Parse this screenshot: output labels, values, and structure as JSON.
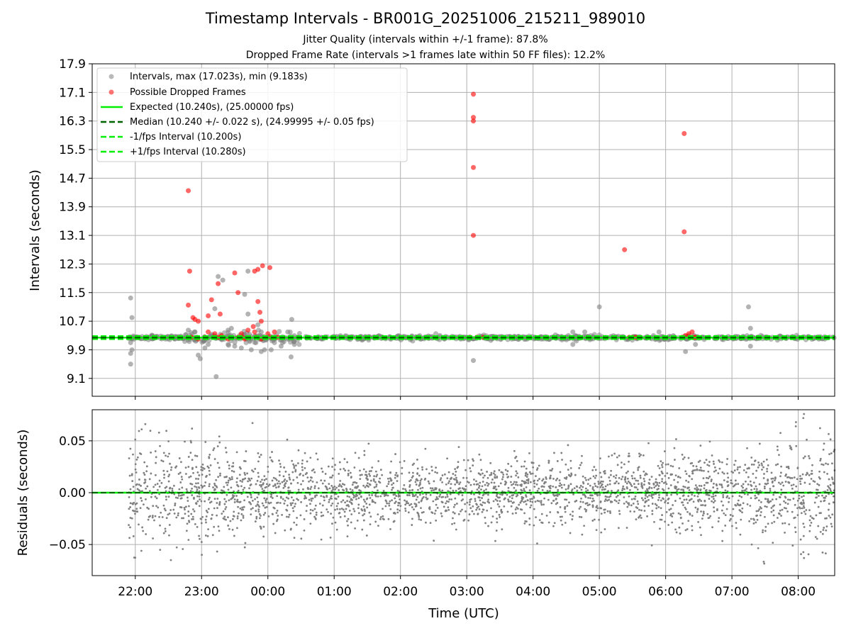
{
  "title": "Timestamp Intervals - BR001G_20251006_215211_989010",
  "subtitle_1": "Jitter Quality (intervals within +/-1 frame): 87.8%",
  "subtitle_2": "Dropped Frame Rate (intervals >1 frames late within 50 FF files): 12.2%",
  "colors": {
    "intervals": "#808080",
    "dropped": "#ff0000",
    "expected": "#00ee00",
    "median": "#006400",
    "fps_bounds": "#00ee00",
    "grid": "#b0b0b0"
  },
  "chart_data": [
    {
      "type": "scatter",
      "panel": "intervals",
      "ylabel": "Intervals (seconds)",
      "xlabel": "",
      "x_unit": "hours since 00:00 UTC",
      "xlim": [
        -2.65,
        8.55
      ],
      "ylim": [
        8.6,
        17.9
      ],
      "yticks": [
        9.1,
        9.9,
        10.7,
        11.5,
        12.3,
        13.1,
        13.9,
        14.7,
        15.5,
        16.3,
        17.1,
        17.9
      ],
      "ytick_labels": [
        "9.1",
        "9.9",
        "10.7",
        "11.5",
        "12.3",
        "13.1",
        "13.9",
        "14.7",
        "15.5",
        "16.3",
        "17.1",
        "17.9"
      ],
      "grid": true,
      "legend_position": "top-left",
      "legend": [
        "Intervals, max (17.023s), min (9.183s)",
        "Possible Dropped Frames",
        "Expected (10.240s), (25.00000 fps)",
        "Median (10.240 +/- 0.022 s), (24.99995 +/- 0.05 fps)",
        "-1/fps Interval (10.200s)",
        "+1/fps Interval (10.280s)"
      ],
      "reference_lines": {
        "expected": 10.24,
        "median": 10.24,
        "minus_fps": 10.2,
        "plus_fps": 10.28
      },
      "series": [
        {
          "name": "Intervals, max (17.023s), min (9.183s)",
          "points": [
            [
              -2.07,
              11.35
            ],
            [
              -2.05,
              10.8
            ],
            [
              -2.07,
              10.1
            ],
            [
              -2.05,
              9.9
            ],
            [
              -2.07,
              9.8
            ],
            [
              -2.07,
              9.5
            ],
            [
              -1.2,
              10.45
            ],
            [
              -1.1,
              10.4
            ],
            [
              -1.05,
              9.75
            ],
            [
              -1.02,
              9.65
            ],
            [
              -0.95,
              9.95
            ],
            [
              -0.9,
              10.05
            ],
            [
              -0.8,
              11.05
            ],
            [
              -0.78,
              9.15
            ],
            [
              -0.75,
              11.95
            ],
            [
              -0.68,
              11.85
            ],
            [
              -0.55,
              10.5
            ],
            [
              -0.5,
              10.0
            ],
            [
              -0.4,
              9.95
            ],
            [
              -0.6,
              10.05
            ],
            [
              -0.6,
              10.45
            ],
            [
              -0.35,
              11.45
            ],
            [
              -0.3,
              10.9
            ],
            [
              -0.25,
              9.9
            ],
            [
              -0.18,
              10.1
            ],
            [
              -0.15,
              10.6
            ],
            [
              -0.1,
              9.85
            ],
            [
              -0.05,
              9.9
            ],
            [
              -0.3,
              12.1
            ],
            [
              -0.1,
              10.4
            ],
            [
              0.05,
              9.9
            ],
            [
              0.1,
              10.1
            ],
            [
              0.2,
              10.0
            ],
            [
              0.3,
              10.4
            ],
            [
              0.35,
              9.7
            ],
            [
              0.36,
              10.75
            ],
            [
              0.4,
              10.05
            ],
            [
              3.1,
              9.6
            ],
            [
              4.6,
              10.4
            ],
            [
              4.6,
              10.05
            ],
            [
              4.78,
              10.4
            ],
            [
              5.0,
              11.1
            ],
            [
              5.9,
              10.4
            ],
            [
              6.3,
              9.85
            ],
            [
              7.25,
              11.1
            ],
            [
              7.28,
              10.5
            ],
            [
              7.28,
              10.0
            ],
            [
              6.45,
              10.05
            ]
          ]
        },
        {
          "name": "Possible Dropped Frames",
          "points": [
            [
              -1.2,
              14.35
            ],
            [
              -1.18,
              12.1
            ],
            [
              -1.2,
              11.15
            ],
            [
              -1.13,
              10.8
            ],
            [
              -1.1,
              10.75
            ],
            [
              -1.05,
              10.7
            ],
            [
              -0.9,
              10.85
            ],
            [
              -0.9,
              10.4
            ],
            [
              -0.8,
              10.35
            ],
            [
              -0.85,
              11.3
            ],
            [
              -0.75,
              11.75
            ],
            [
              -0.72,
              10.9
            ],
            [
              -0.5,
              12.05
            ],
            [
              -0.45,
              11.5
            ],
            [
              -0.4,
              10.35
            ],
            [
              -0.3,
              10.45
            ],
            [
              -0.22,
              10.55
            ],
            [
              -0.2,
              12.1
            ],
            [
              -0.15,
              11.25
            ],
            [
              -0.12,
              10.95
            ],
            [
              -0.1,
              10.7
            ],
            [
              -0.15,
              12.15
            ],
            [
              -0.08,
              12.25
            ],
            [
              0.03,
              12.2
            ],
            [
              -0.2,
              10.4
            ],
            [
              0.0,
              10.35
            ],
            [
              0.1,
              10.4
            ],
            [
              3.1,
              17.05
            ],
            [
              3.1,
              16.4
            ],
            [
              3.1,
              16.3
            ],
            [
              3.1,
              15.0
            ],
            [
              3.1,
              13.1
            ],
            [
              5.38,
              12.7
            ],
            [
              6.28,
              15.95
            ],
            [
              6.28,
              13.2
            ],
            [
              6.3,
              10.3
            ],
            [
              6.4,
              10.4
            ],
            [
              6.35,
              10.35
            ],
            [
              -1.15,
              10.25
            ],
            [
              -1.05,
              10.2
            ],
            [
              -0.95,
              10.25
            ],
            [
              -0.75,
              10.25
            ],
            [
              -0.7,
              10.3
            ],
            [
              -0.6,
              10.2
            ],
            [
              -0.45,
              10.25
            ],
            [
              -0.38,
              10.25
            ],
            [
              -0.35,
              10.2
            ],
            [
              -0.18,
              10.25
            ],
            [
              -0.1,
              10.2
            ],
            [
              0.05,
              10.25
            ],
            [
              0.15,
              10.25
            ],
            [
              3.05,
              10.25
            ],
            [
              3.15,
              10.25
            ],
            [
              3.25,
              10.25
            ],
            [
              5.45,
              10.25
            ],
            [
              5.5,
              10.25
            ],
            [
              5.55,
              10.25
            ],
            [
              6.25,
              10.25
            ],
            [
              6.42,
              10.25
            ],
            [
              6.45,
              10.25
            ]
          ]
        }
      ]
    },
    {
      "type": "scatter",
      "panel": "residuals",
      "ylabel": "Residuals (seconds)",
      "xlabel": "Time (UTC)",
      "x_unit": "hours since 00:00 UTC",
      "xlim": [
        -2.65,
        8.55
      ],
      "ylim": [
        -0.08,
        0.08
      ],
      "yticks": [
        -0.05,
        0.0,
        0.05
      ],
      "ytick_labels": [
        "−0.05",
        "0.00",
        "0.05"
      ],
      "xticks": [
        -2,
        -1,
        0,
        1,
        2,
        3,
        4,
        5,
        6,
        7,
        8
      ],
      "xtick_labels": [
        "22:00",
        "23:00",
        "00:00",
        "01:00",
        "02:00",
        "03:00",
        "04:00",
        "05:00",
        "06:00",
        "07:00",
        "08:00"
      ],
      "grid": true,
      "reference_line": 0.0,
      "series": [
        {
          "name": "Residuals",
          "x_range": [
            -2.1,
            8.55
          ],
          "point_count": 2800,
          "std_dev_start": 0.026,
          "std_dev_middle": 0.015,
          "std_dev_end": 0.027
        }
      ]
    }
  ]
}
